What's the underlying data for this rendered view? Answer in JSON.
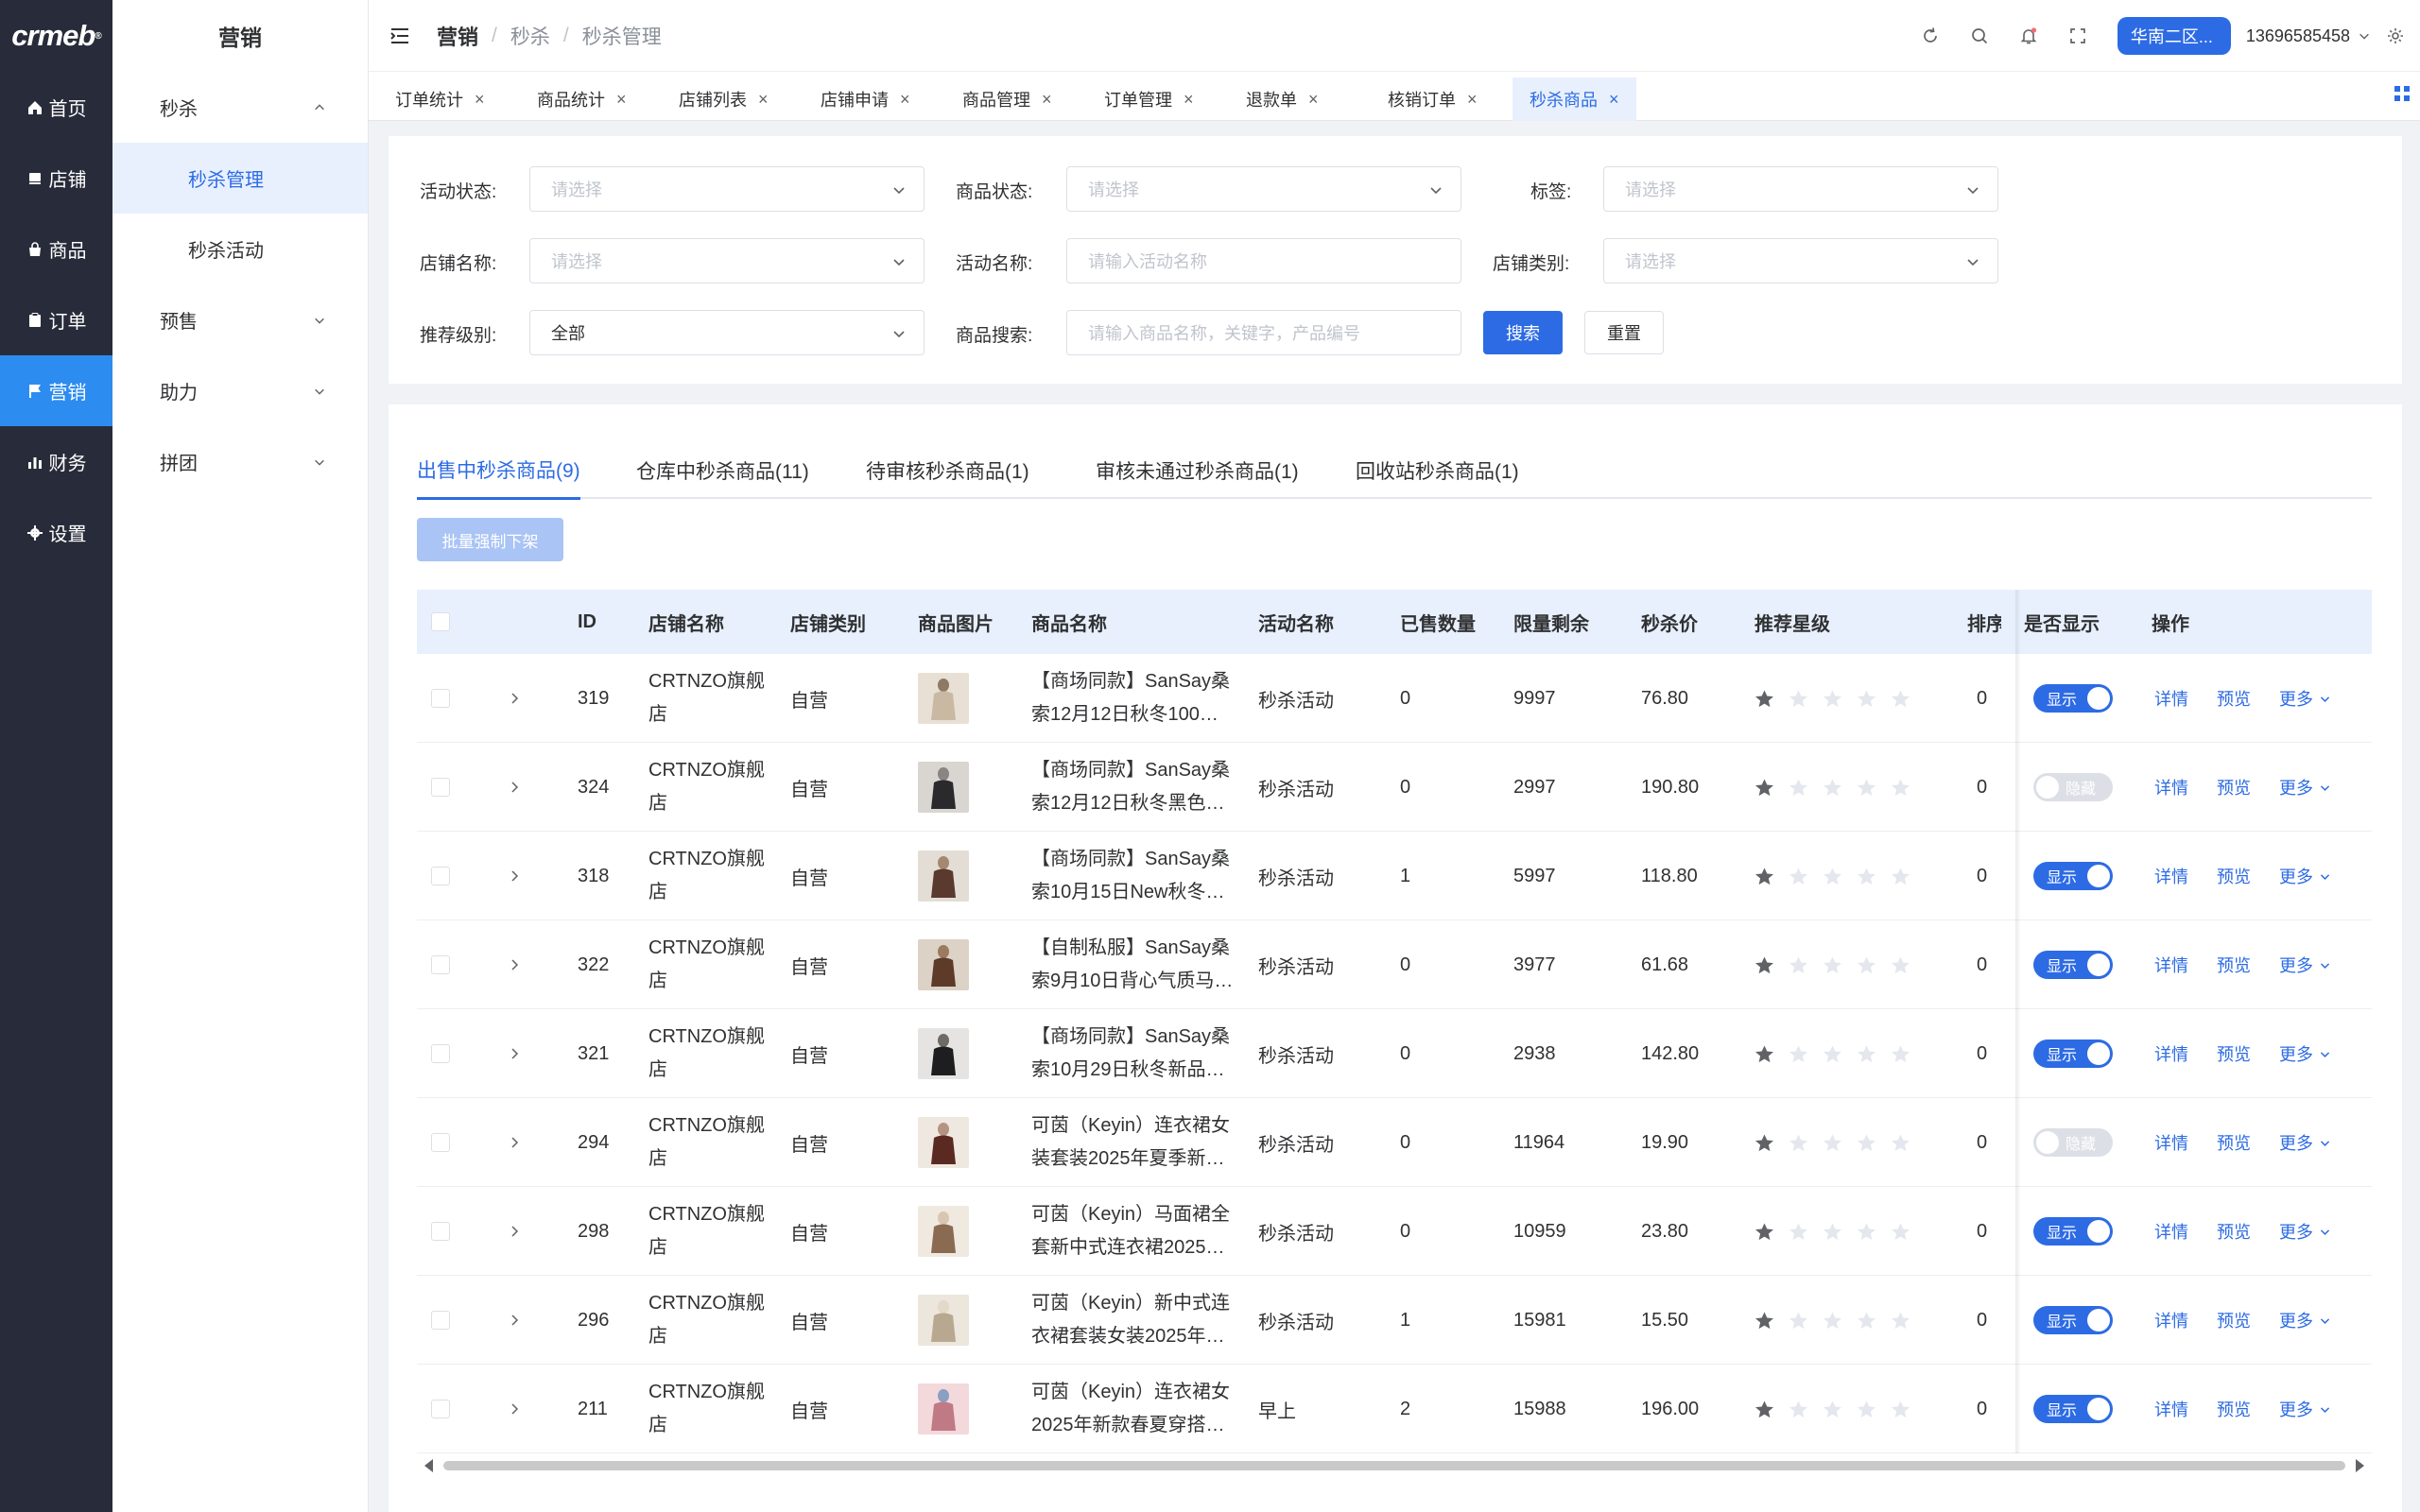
{
  "logo": {
    "text": "crmeb",
    "mark": "®"
  },
  "rail": [
    {
      "label": "首页",
      "icon": "home-icon"
    },
    {
      "label": "店铺",
      "icon": "store-icon"
    },
    {
      "label": "商品",
      "icon": "bag-icon"
    },
    {
      "label": "订单",
      "icon": "clipboard-icon"
    },
    {
      "label": "营销",
      "icon": "flag-icon",
      "active": true
    },
    {
      "label": "财务",
      "icon": "bar-chart-icon"
    },
    {
      "label": "设置",
      "icon": "gear-icon"
    }
  ],
  "subnav": {
    "title": "营销",
    "groups": [
      {
        "label": "秒杀",
        "expanded": true,
        "children": [
          {
            "label": "秒杀管理",
            "active": true
          },
          {
            "label": "秒杀活动"
          }
        ]
      },
      {
        "label": "预售"
      },
      {
        "label": "助力"
      },
      {
        "label": "拼团"
      }
    ]
  },
  "header": {
    "breadcrumb": [
      "营销",
      "秒杀",
      "秒杀管理"
    ],
    "region_button": "华南二区...",
    "user": "13696585458"
  },
  "tabs": [
    {
      "label": "订单统计"
    },
    {
      "label": "商品统计"
    },
    {
      "label": "店铺列表"
    },
    {
      "label": "店铺申请"
    },
    {
      "label": "商品管理"
    },
    {
      "label": "订单管理"
    },
    {
      "label": "退款单"
    },
    {
      "label": "核销订单"
    },
    {
      "label": "秒杀商品",
      "active": true
    }
  ],
  "filters": {
    "activity_status": {
      "label": "活动状态:",
      "placeholder": "请选择"
    },
    "product_status": {
      "label": "商品状态:",
      "placeholder": "请选择"
    },
    "tag": {
      "label": "标签:",
      "placeholder": "请选择"
    },
    "store_name": {
      "label": "店铺名称:",
      "placeholder": "请选择"
    },
    "activity_name": {
      "label": "活动名称:",
      "placeholder": "请输入活动名称"
    },
    "store_type": {
      "label": "店铺类别:",
      "placeholder": "请选择"
    },
    "rec_level": {
      "label": "推荐级别:",
      "value": "全部"
    },
    "product_search": {
      "label": "商品搜索:",
      "placeholder": "请输入商品名称，关键字，产品编号"
    },
    "search_button": "搜索",
    "reset_button": "重置"
  },
  "status_tabs": [
    {
      "label": "出售中秒杀商品(9)",
      "active": true
    },
    {
      "label": "仓库中秒杀商品(11)"
    },
    {
      "label": "待审核秒杀商品(1)"
    },
    {
      "label": "审核未通过秒杀商品(1)"
    },
    {
      "label": "回收站秒杀商品(1)"
    }
  ],
  "batch_button": "批量强制下架",
  "table": {
    "columns": [
      "ID",
      "店铺名称",
      "店铺类别",
      "商品图片",
      "商品名称",
      "活动名称",
      "已售数量",
      "限量剩余",
      "秒杀价",
      "推荐星级",
      "排序",
      "是否显示",
      "操作"
    ],
    "rows": [
      {
        "id": "319",
        "store": [
          "CRTNZO旗舰",
          "店"
        ],
        "type": "自营",
        "name": [
          "【商场同款】SanSay桑",
          "索12月12日秋冬100…"
        ],
        "activity": "秒杀活动",
        "sold": "0",
        "remain": "9997",
        "price": "76.80",
        "stars": 1,
        "sort": "0",
        "show": true,
        "img_colors": [
          "#e8e0d4",
          "#c9b9a3",
          "#8d7a66"
        ]
      },
      {
        "id": "324",
        "store": [
          "CRTNZO旗舰",
          "店"
        ],
        "type": "自营",
        "name": [
          "【商场同款】SanSay桑",
          "索12月12日秋冬黑色…"
        ],
        "activity": "秒杀活动",
        "sold": "0",
        "remain": "2997",
        "price": "190.80",
        "stars": 1,
        "sort": "0",
        "show": false,
        "img_colors": [
          "#d9d6d2",
          "#2a2a2c",
          "#8a8580"
        ]
      },
      {
        "id": "318",
        "store": [
          "CRTNZO旗舰",
          "店"
        ],
        "type": "自营",
        "name": [
          "【商场同款】SanSay桑",
          "索10月15日New秋冬…"
        ],
        "activity": "秒杀活动",
        "sold": "1",
        "remain": "5997",
        "price": "118.80",
        "stars": 1,
        "sort": "0",
        "show": true,
        "img_colors": [
          "#e4ddd5",
          "#5a3a2e",
          "#a48872"
        ]
      },
      {
        "id": "322",
        "store": [
          "CRTNZO旗舰",
          "店"
        ],
        "type": "自营",
        "name": [
          "【自制私服】SanSay桑",
          "索9月10日背心气质马…"
        ],
        "activity": "秒杀活动",
        "sold": "0",
        "remain": "3977",
        "price": "61.68",
        "stars": 1,
        "sort": "0",
        "show": true,
        "img_colors": [
          "#dcd2c6",
          "#5e3a28",
          "#9c7a60"
        ]
      },
      {
        "id": "321",
        "store": [
          "CRTNZO旗舰",
          "店"
        ],
        "type": "自营",
        "name": [
          "【商场同款】SanSay桑",
          "索10月29日秋冬新品…"
        ],
        "activity": "秒杀活动",
        "sold": "0",
        "remain": "2938",
        "price": "142.80",
        "stars": 1,
        "sort": "0",
        "show": true,
        "img_colors": [
          "#e6e4e2",
          "#1e1e20",
          "#6e6a66"
        ]
      },
      {
        "id": "294",
        "store": [
          "CRTNZO旗舰",
          "店"
        ],
        "type": "自营",
        "name": [
          "可茵（Keyin）连衣裙女",
          "装套装2025年夏季新…"
        ],
        "activity": "秒杀活动",
        "sold": "0",
        "remain": "11964",
        "price": "19.90",
        "stars": 1,
        "sort": "0",
        "show": false,
        "img_colors": [
          "#efe8e0",
          "#5a2a22",
          "#b59380"
        ]
      },
      {
        "id": "298",
        "store": [
          "CRTNZO旗舰",
          "店"
        ],
        "type": "自营",
        "name": [
          "可茵（Keyin）马面裙全",
          "套新中式连衣裙2025…"
        ],
        "activity": "秒杀活动",
        "sold": "0",
        "remain": "10959",
        "price": "23.80",
        "stars": 1,
        "sort": "0",
        "show": true,
        "img_colors": [
          "#f0e9e0",
          "#8b6a52",
          "#d8c6b0"
        ]
      },
      {
        "id": "296",
        "store": [
          "CRTNZO旗舰",
          "店"
        ],
        "type": "自营",
        "name": [
          "可茵（Keyin）新中式连",
          "衣裙套装女装2025年…"
        ],
        "activity": "秒杀活动",
        "sold": "1",
        "remain": "15981",
        "price": "15.50",
        "stars": 1,
        "sort": "0",
        "show": true,
        "img_colors": [
          "#ece6dc",
          "#b8a890",
          "#e4d8c8"
        ]
      },
      {
        "id": "211",
        "store": [
          "CRTNZO旗舰",
          "店"
        ],
        "type": "自营",
        "name": [
          "可茵（Keyin）连衣裙女",
          "2025年新款春夏穿搭…"
        ],
        "activity": "早上",
        "sold": "2",
        "remain": "15988",
        "price": "196.00",
        "stars": 1,
        "sort": "0",
        "show": true,
        "img_colors": [
          "#f3d9dc",
          "#c07a86",
          "#8aa0c0"
        ]
      }
    ],
    "toggle_on_label": "显示",
    "toggle_off_label": "隐藏",
    "ops": {
      "detail": "详情",
      "preview": "预览",
      "more": "更多"
    }
  },
  "colors": {
    "accent": "#2d6be4",
    "rail_bg": "#282c3a",
    "rail_active": "#2d8cf0",
    "header_row": "#e8f0fd"
  }
}
